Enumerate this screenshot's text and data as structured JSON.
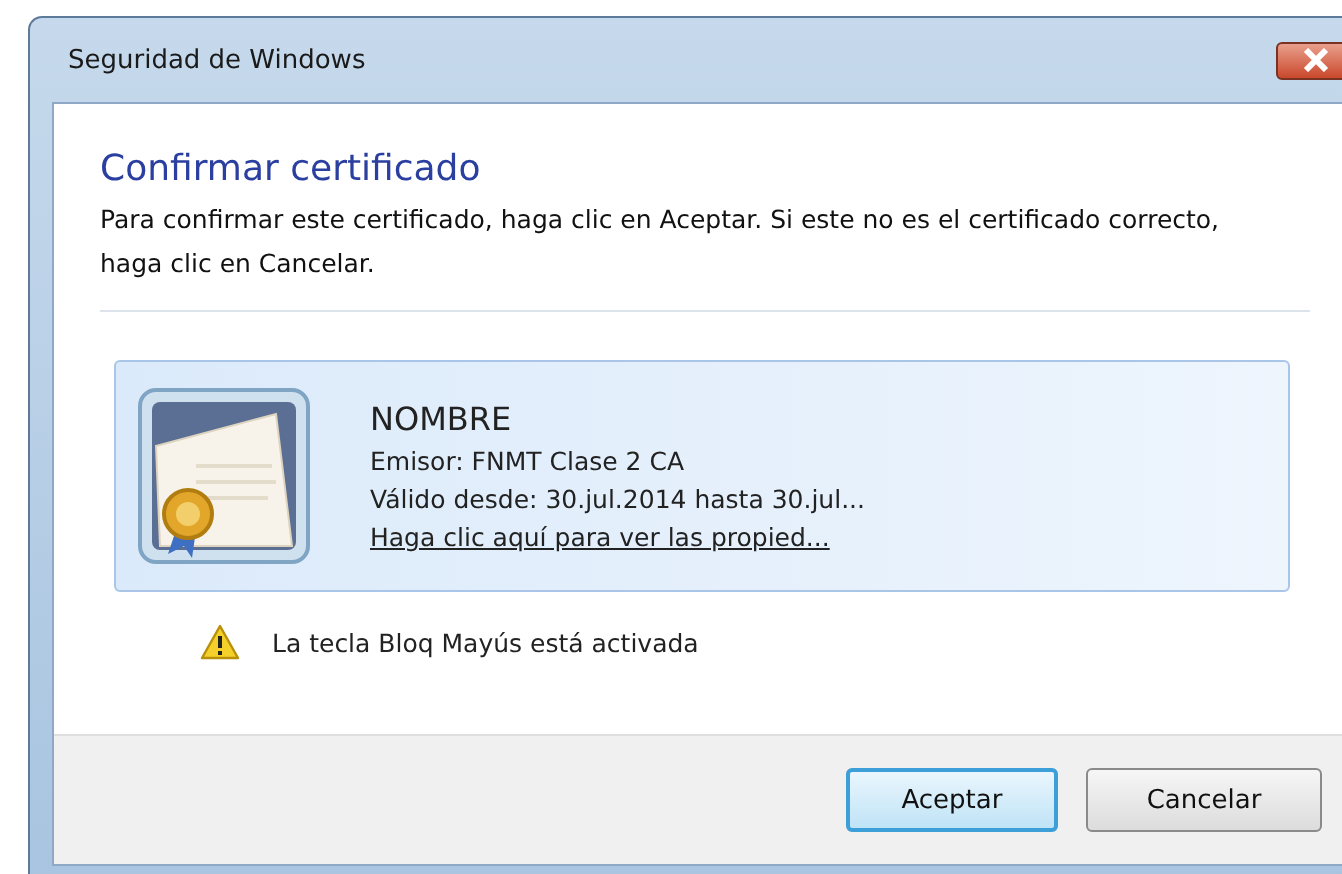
{
  "window": {
    "title": "Seguridad de Windows"
  },
  "heading": "Confirmar certificado",
  "instructions": "Para confirmar este certificado, haga clic en Aceptar. Si este no es el certificado correcto, haga clic en Cancelar.",
  "certificate": {
    "name": "NOMBRE",
    "issuer": "Emisor: FNMT Clase 2 CA",
    "validity": "Válido desde: 30.jul.2014 hasta 30.jul...",
    "link": "Haga clic aquí para ver las propied..."
  },
  "warning": "La tecla Bloq Mayús está activada",
  "buttons": [
    {
      "label": "Aceptar",
      "default": true
    },
    {
      "label": "Cancelar",
      "default": false
    }
  ]
}
